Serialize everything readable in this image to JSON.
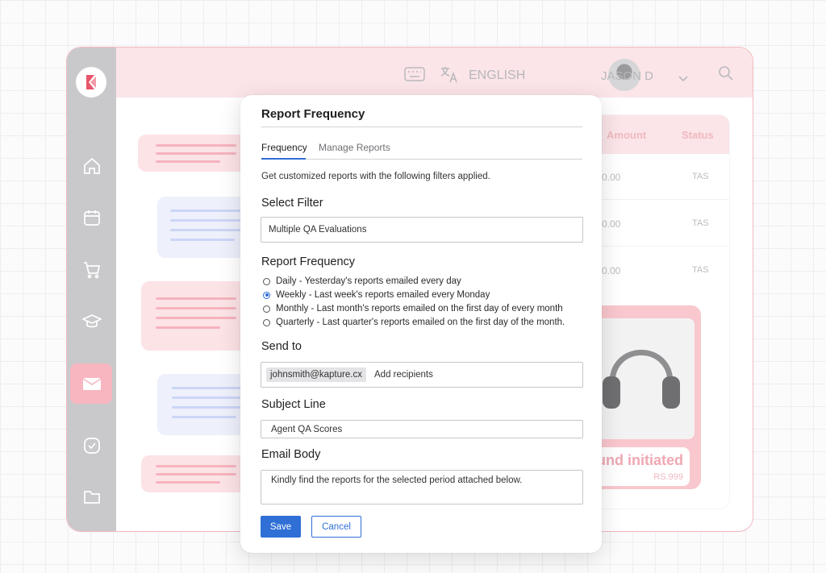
{
  "background": {
    "header": {
      "language": "ENGLISH",
      "user_name": "JASON D"
    },
    "table": {
      "columns": [
        "Amount",
        "Status"
      ],
      "rows": [
        {
          "amount": "0.00",
          "status": "TAS"
        },
        {
          "amount": "0.00",
          "status": "TAS"
        },
        {
          "amount": "0.00",
          "status": "TAS"
        }
      ]
    },
    "product": {
      "status": "und initiated",
      "price": "RS.999"
    },
    "colors": {
      "accent_pink": "#f7b6c0",
      "sidebar_gray": "#c9c9cb"
    }
  },
  "modal": {
    "title": "Report Frequency",
    "tabs": [
      {
        "label": "Frequency",
        "active": true
      },
      {
        "label": "Manage Reports",
        "active": false
      }
    ],
    "description": "Get customized reports with the following filters applied.",
    "select_filter": {
      "label": "Select Filter",
      "value": "Multiple QA Evaluations"
    },
    "report_frequency": {
      "label": "Report Frequency",
      "options": [
        {
          "label": "Daily - Yesterday's reports emailed every day",
          "selected": false
        },
        {
          "label": "Weekly - Last week's reports emailed every Monday",
          "selected": true
        },
        {
          "label": "Monthly - Last month's reports emailed on the first day of every month",
          "selected": false
        },
        {
          "label": "Quarterly - Last quarter's reports emailed on the first day of the month.",
          "selected": false
        }
      ]
    },
    "send_to": {
      "label": "Send to",
      "recipient": "johnsmith@kapture.cx",
      "placeholder": "Add recipients"
    },
    "subject": {
      "label": "Subject Line",
      "value": "Agent QA Scores"
    },
    "email_body": {
      "label": "Email Body",
      "value": "Kindly find the reports for the selected period attached below."
    },
    "buttons": {
      "save": "Save",
      "cancel": "Cancel"
    },
    "colors": {
      "primary": "#2f6fd6"
    }
  }
}
